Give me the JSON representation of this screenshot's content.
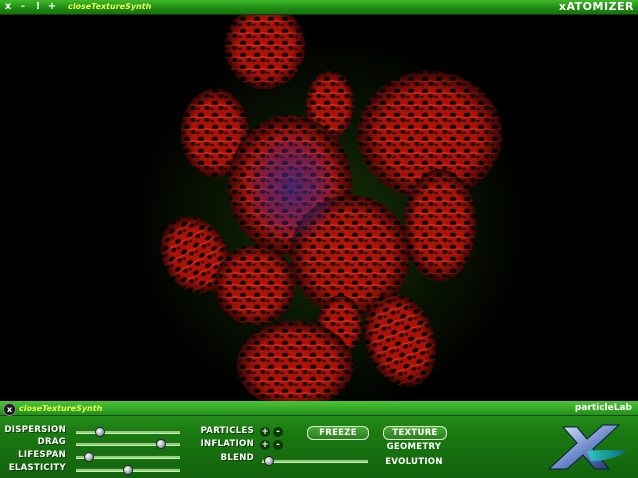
{
  "window": {
    "controls": [
      "x",
      "-",
      "!",
      "+"
    ],
    "title": "closeTextureSynth",
    "app_name": "xATOMIZER"
  },
  "panel": {
    "close_label": "x",
    "title": "closeTextureSynth",
    "app_name": "particleLab",
    "sliders": [
      {
        "label": "DISPERSION",
        "value": 0.2
      },
      {
        "label": "DRAG",
        "value": 0.85
      },
      {
        "label": "LIFESPAN",
        "value": 0.08
      },
      {
        "label": "ELASTICITY",
        "value": 0.5
      }
    ],
    "particles_label": "PARTICLES",
    "inflation_label": "INFLATION",
    "blend_label": "BLEND",
    "blend_value": 0.02,
    "plus": "+",
    "minus": "-",
    "freeze_label": "FREEZE",
    "texture_label": "TEXTURE",
    "geometry_label": "GEOMETRY",
    "evolution_label": "EVOLUTION"
  },
  "colors": {
    "bar_green": "#22911a",
    "title_yellow": "#e8ff55",
    "particle_red": "#e01a0a",
    "background": "#000000"
  },
  "icons": {
    "logo": "xatomizer-x-logo"
  }
}
